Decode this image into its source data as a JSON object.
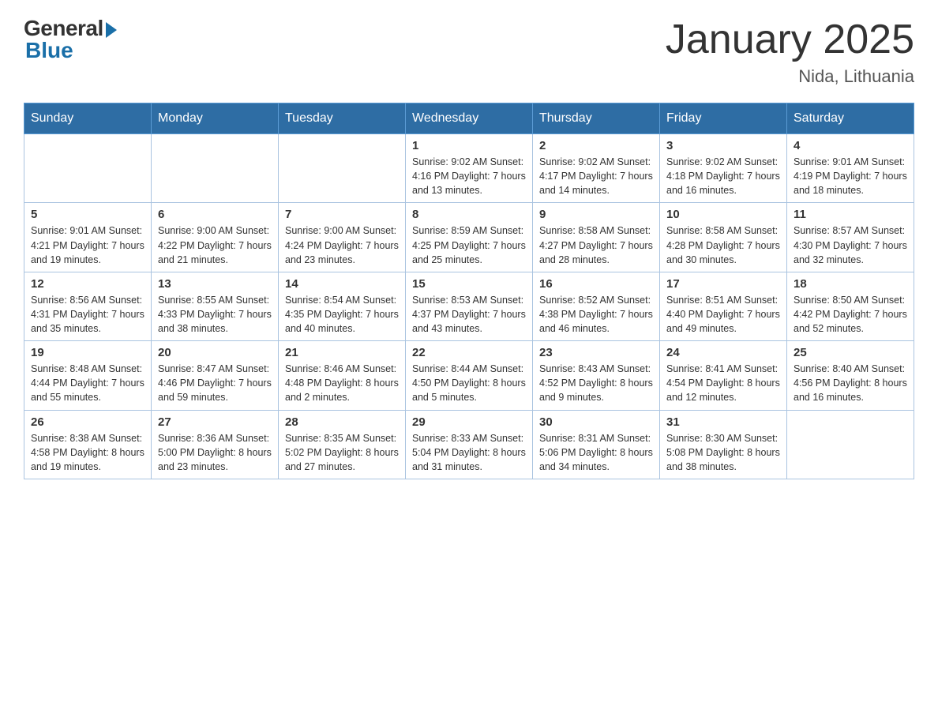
{
  "header": {
    "logo": {
      "general": "General",
      "blue": "Blue"
    },
    "title": "January 2025",
    "subtitle": "Nida, Lithuania"
  },
  "weekdays": [
    "Sunday",
    "Monday",
    "Tuesday",
    "Wednesday",
    "Thursday",
    "Friday",
    "Saturday"
  ],
  "weeks": [
    [
      {
        "day": "",
        "info": ""
      },
      {
        "day": "",
        "info": ""
      },
      {
        "day": "",
        "info": ""
      },
      {
        "day": "1",
        "info": "Sunrise: 9:02 AM\nSunset: 4:16 PM\nDaylight: 7 hours\nand 13 minutes."
      },
      {
        "day": "2",
        "info": "Sunrise: 9:02 AM\nSunset: 4:17 PM\nDaylight: 7 hours\nand 14 minutes."
      },
      {
        "day": "3",
        "info": "Sunrise: 9:02 AM\nSunset: 4:18 PM\nDaylight: 7 hours\nand 16 minutes."
      },
      {
        "day": "4",
        "info": "Sunrise: 9:01 AM\nSunset: 4:19 PM\nDaylight: 7 hours\nand 18 minutes."
      }
    ],
    [
      {
        "day": "5",
        "info": "Sunrise: 9:01 AM\nSunset: 4:21 PM\nDaylight: 7 hours\nand 19 minutes."
      },
      {
        "day": "6",
        "info": "Sunrise: 9:00 AM\nSunset: 4:22 PM\nDaylight: 7 hours\nand 21 minutes."
      },
      {
        "day": "7",
        "info": "Sunrise: 9:00 AM\nSunset: 4:24 PM\nDaylight: 7 hours\nand 23 minutes."
      },
      {
        "day": "8",
        "info": "Sunrise: 8:59 AM\nSunset: 4:25 PM\nDaylight: 7 hours\nand 25 minutes."
      },
      {
        "day": "9",
        "info": "Sunrise: 8:58 AM\nSunset: 4:27 PM\nDaylight: 7 hours\nand 28 minutes."
      },
      {
        "day": "10",
        "info": "Sunrise: 8:58 AM\nSunset: 4:28 PM\nDaylight: 7 hours\nand 30 minutes."
      },
      {
        "day": "11",
        "info": "Sunrise: 8:57 AM\nSunset: 4:30 PM\nDaylight: 7 hours\nand 32 minutes."
      }
    ],
    [
      {
        "day": "12",
        "info": "Sunrise: 8:56 AM\nSunset: 4:31 PM\nDaylight: 7 hours\nand 35 minutes."
      },
      {
        "day": "13",
        "info": "Sunrise: 8:55 AM\nSunset: 4:33 PM\nDaylight: 7 hours\nand 38 minutes."
      },
      {
        "day": "14",
        "info": "Sunrise: 8:54 AM\nSunset: 4:35 PM\nDaylight: 7 hours\nand 40 minutes."
      },
      {
        "day": "15",
        "info": "Sunrise: 8:53 AM\nSunset: 4:37 PM\nDaylight: 7 hours\nand 43 minutes."
      },
      {
        "day": "16",
        "info": "Sunrise: 8:52 AM\nSunset: 4:38 PM\nDaylight: 7 hours\nand 46 minutes."
      },
      {
        "day": "17",
        "info": "Sunrise: 8:51 AM\nSunset: 4:40 PM\nDaylight: 7 hours\nand 49 minutes."
      },
      {
        "day": "18",
        "info": "Sunrise: 8:50 AM\nSunset: 4:42 PM\nDaylight: 7 hours\nand 52 minutes."
      }
    ],
    [
      {
        "day": "19",
        "info": "Sunrise: 8:48 AM\nSunset: 4:44 PM\nDaylight: 7 hours\nand 55 minutes."
      },
      {
        "day": "20",
        "info": "Sunrise: 8:47 AM\nSunset: 4:46 PM\nDaylight: 7 hours\nand 59 minutes."
      },
      {
        "day": "21",
        "info": "Sunrise: 8:46 AM\nSunset: 4:48 PM\nDaylight: 8 hours\nand 2 minutes."
      },
      {
        "day": "22",
        "info": "Sunrise: 8:44 AM\nSunset: 4:50 PM\nDaylight: 8 hours\nand 5 minutes."
      },
      {
        "day": "23",
        "info": "Sunrise: 8:43 AM\nSunset: 4:52 PM\nDaylight: 8 hours\nand 9 minutes."
      },
      {
        "day": "24",
        "info": "Sunrise: 8:41 AM\nSunset: 4:54 PM\nDaylight: 8 hours\nand 12 minutes."
      },
      {
        "day": "25",
        "info": "Sunrise: 8:40 AM\nSunset: 4:56 PM\nDaylight: 8 hours\nand 16 minutes."
      }
    ],
    [
      {
        "day": "26",
        "info": "Sunrise: 8:38 AM\nSunset: 4:58 PM\nDaylight: 8 hours\nand 19 minutes."
      },
      {
        "day": "27",
        "info": "Sunrise: 8:36 AM\nSunset: 5:00 PM\nDaylight: 8 hours\nand 23 minutes."
      },
      {
        "day": "28",
        "info": "Sunrise: 8:35 AM\nSunset: 5:02 PM\nDaylight: 8 hours\nand 27 minutes."
      },
      {
        "day": "29",
        "info": "Sunrise: 8:33 AM\nSunset: 5:04 PM\nDaylight: 8 hours\nand 31 minutes."
      },
      {
        "day": "30",
        "info": "Sunrise: 8:31 AM\nSunset: 5:06 PM\nDaylight: 8 hours\nand 34 minutes."
      },
      {
        "day": "31",
        "info": "Sunrise: 8:30 AM\nSunset: 5:08 PM\nDaylight: 8 hours\nand 38 minutes."
      },
      {
        "day": "",
        "info": ""
      }
    ]
  ]
}
